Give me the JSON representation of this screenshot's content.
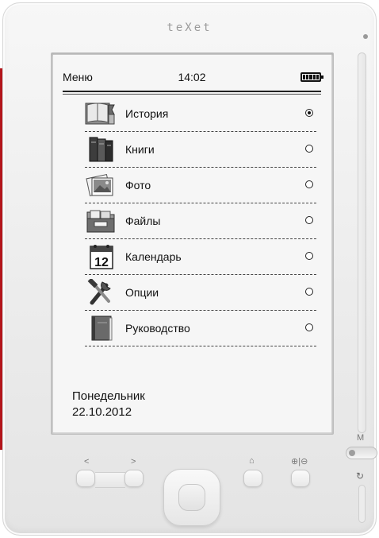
{
  "device": {
    "brand": "teXet",
    "side_label": "M"
  },
  "status_bar": {
    "title": "Меню",
    "time": "14:02",
    "battery": "battery-full-icon"
  },
  "menu": {
    "items": [
      {
        "label": "История",
        "icon": "history-book-icon",
        "selected": true
      },
      {
        "label": "Книги",
        "icon": "books-icon",
        "selected": false
      },
      {
        "label": "Фото",
        "icon": "photo-icon",
        "selected": false
      },
      {
        "label": "Файлы",
        "icon": "folder-icon",
        "selected": false
      },
      {
        "label": "Календарь",
        "icon": "calendar-icon",
        "selected": false
      },
      {
        "label": "Опции",
        "icon": "tools-icon",
        "selected": false
      },
      {
        "label": "Руководство",
        "icon": "manual-icon",
        "selected": false
      }
    ]
  },
  "calendar_icon_day": "12",
  "footer": {
    "weekday": "Понедельник",
    "date": "22.10.2012"
  },
  "buttons": {
    "prev": "<",
    "next": ">",
    "home": "⌂",
    "zoom": "⊕|⊖"
  },
  "colors": {
    "accent_red": "#b3151b",
    "device_body": "#ececec",
    "screen": "#f6f6f6"
  }
}
